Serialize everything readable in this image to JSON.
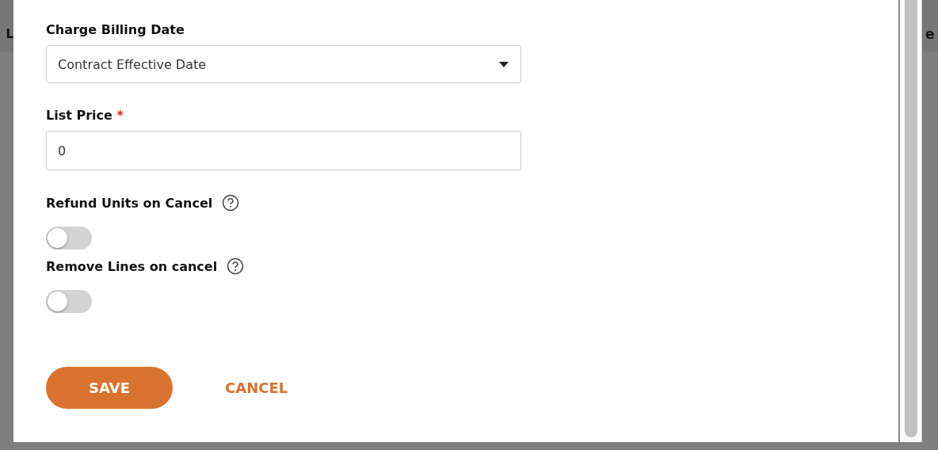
{
  "background": {
    "left_text": "L",
    "right_text": "e"
  },
  "dialog": {
    "charge_billing_date": {
      "label": "Charge Billing Date",
      "value": "Contract Effective Date"
    },
    "list_price": {
      "label": "List Price",
      "required_mark": "*",
      "value": "0"
    },
    "toggles": [
      {
        "label": "Refund Units on Cancel",
        "on": false
      },
      {
        "label": "Remove Lines on cancel",
        "on": false
      }
    ],
    "buttons": [
      {
        "label": "SAVE",
        "kind": "primary"
      },
      {
        "label": "CANCEL",
        "kind": "text"
      }
    ]
  }
}
